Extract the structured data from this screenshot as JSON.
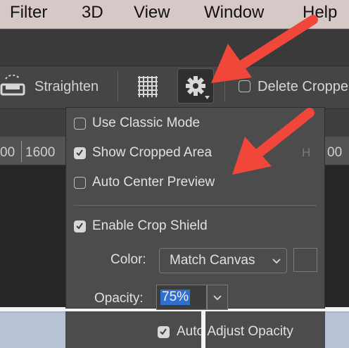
{
  "menubar": {
    "items": [
      "Filter",
      "3D",
      "View",
      "Window",
      "Help"
    ]
  },
  "options_bar": {
    "straighten_label": "Straighten",
    "delete_cropped_label": "Delete Croppe",
    "delete_cropped_checked": false
  },
  "ruler": {
    "numbers": [
      "00",
      "1600",
      "00"
    ],
    "h_label": "H"
  },
  "crop_options_menu": {
    "use_classic_mode": {
      "label": "Use Classic Mode",
      "checked": false
    },
    "show_cropped_area": {
      "label": "Show Cropped Area",
      "checked": true
    },
    "auto_center_preview": {
      "label": "Auto Center Preview",
      "checked": false
    },
    "enable_crop_shield": {
      "label": "Enable Crop Shield",
      "checked": true
    },
    "color_label": "Color:",
    "color_value": "Match Canvas",
    "opacity_label": "Opacity:",
    "opacity_value": "75%",
    "auto_adjust_opacity": {
      "label": "Auto Adjust Opacity",
      "checked": true
    }
  },
  "annotations": {
    "arrow_color": "#f0473a",
    "arrow_count": 2
  },
  "icons": [
    "straighten-icon",
    "grid-overlay-icon",
    "gear-icon",
    "chevron-down-icon",
    "arrow-annotation"
  ]
}
